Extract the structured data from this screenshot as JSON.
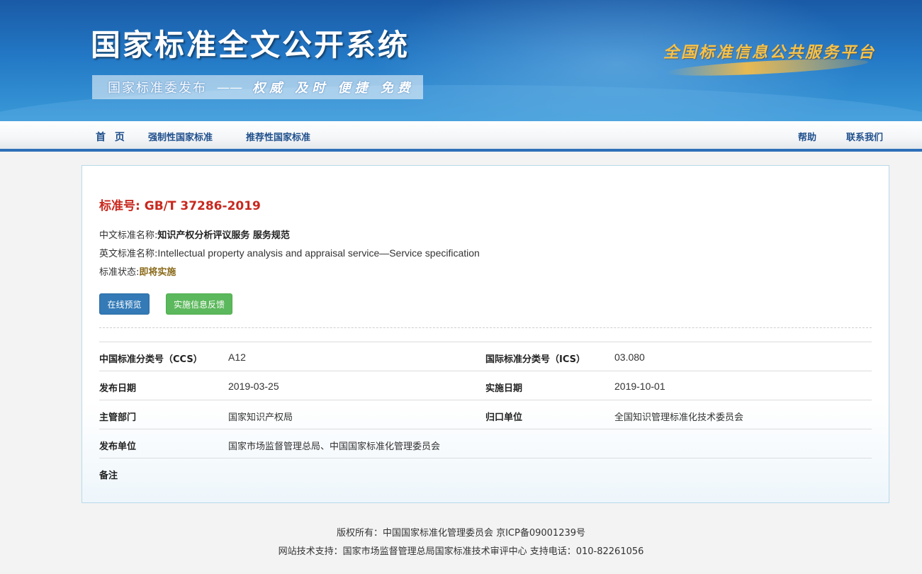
{
  "header": {
    "site_title": "国家标准全文公开系统",
    "subtitle_publisher": "国家标准委发布",
    "subtitle_dash": "——",
    "subtitle_slogan": "权威 及时 便捷 免费",
    "platform_logo_text": "全国标准信息公共服务平台"
  },
  "nav": {
    "home": "首 页",
    "mandatory": "强制性国家标准",
    "recommended": "推荐性国家标准",
    "help": "帮助",
    "contact": "联系我们"
  },
  "standard": {
    "number_label": "标准号:",
    "number_value": "GB/T 37286-2019",
    "cn_name_label": "中文标准名称:",
    "cn_name_value": "知识产权分析评议服务 服务规范",
    "en_name_label": "英文标准名称:",
    "en_name_value": "Intellectual property analysis and appraisal service—Service specification",
    "status_label": "标准状态:",
    "status_value": "即将实施"
  },
  "buttons": {
    "preview": "在线预览",
    "feedback": "实施信息反馈"
  },
  "meta": {
    "ccs_label": "中国标准分类号（CCS）",
    "ccs_value": "A12",
    "ics_label": "国际标准分类号（ICS）",
    "ics_value": "03.080",
    "publish_date_label": "发布日期",
    "publish_date_value": "2019-03-25",
    "implement_date_label": "实施日期",
    "implement_date_value": "2019-10-01",
    "authority_label": "主管部门",
    "authority_value": "国家知识产权局",
    "tc_label": "归口单位",
    "tc_value": "全国知识管理标准化技术委员会",
    "publisher_label": "发布单位",
    "publisher_value": "国家市场监督管理总局、中国国家标准化管理委员会",
    "remark_label": "备注",
    "remark_value": ""
  },
  "footer": {
    "copyright": "版权所有：中国国家标准化管理委员会 京ICP备09001239号",
    "support": "网站技术支持：国家市场监督管理总局国家标准技术审评中心 支持电话：010-82261056"
  },
  "colors": {
    "banner_blue": "#2277c4",
    "nav_border": "#2d6fb8",
    "standard_number_red": "#c8281e",
    "preview_button": "#337ab7",
    "feedback_button": "#5cb85c",
    "status_text": "#8a6a1a"
  }
}
